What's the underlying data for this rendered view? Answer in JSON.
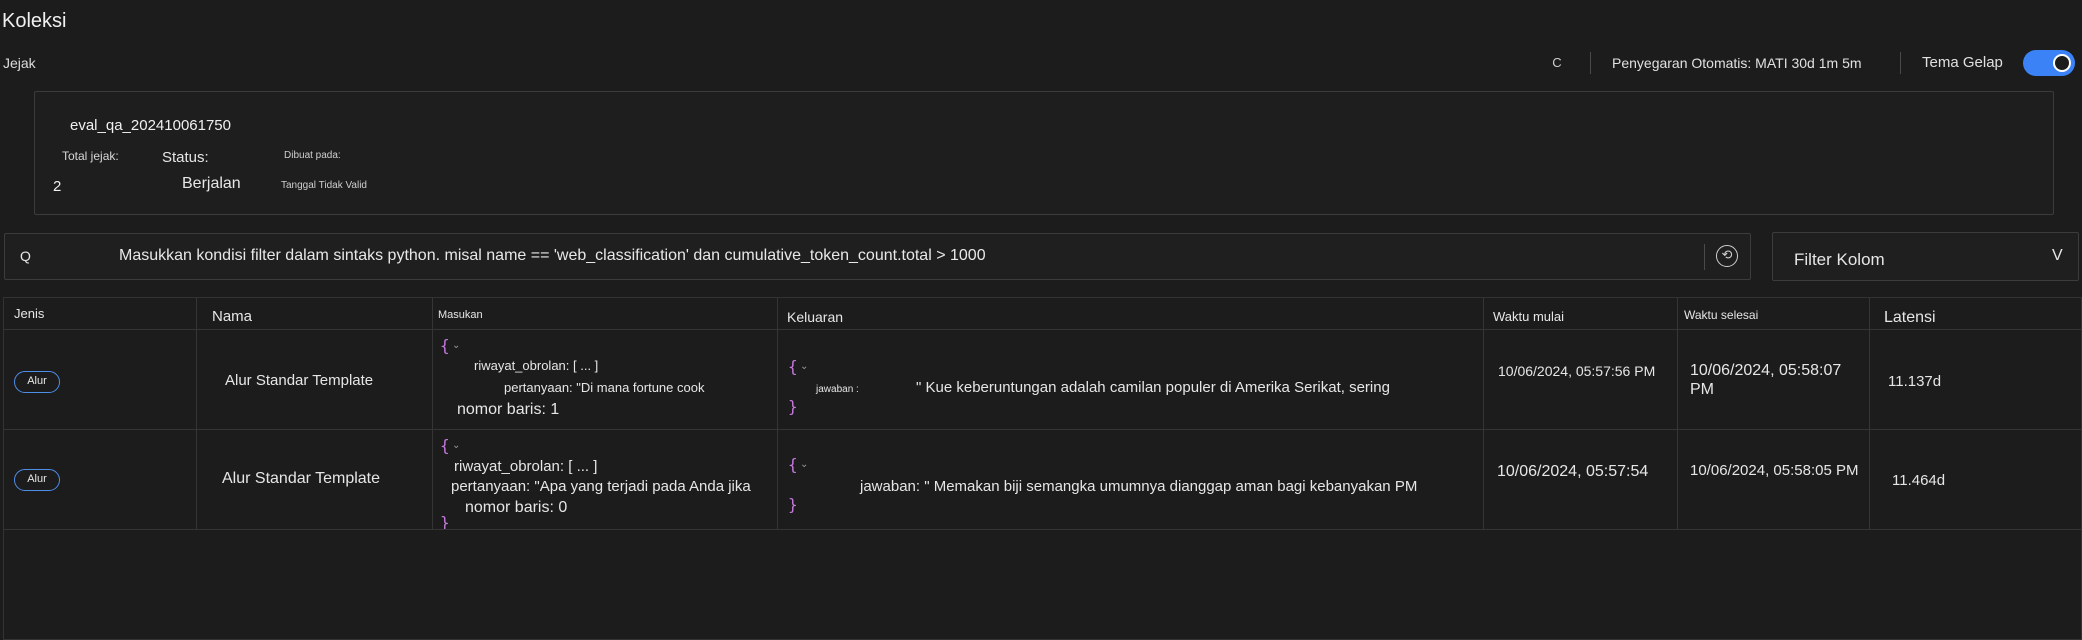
{
  "header": {
    "title": "Koleksi",
    "subtitle": "Jejak",
    "refresh_icon": "C",
    "auto_refresh": "Penyegaran Otomatis: MATI 30d 1m 5m",
    "theme_label": "Tema Gelap",
    "theme_dark_on": true
  },
  "run": {
    "name": "eval_qa_202410061750",
    "total_label": "Total jejak:",
    "total_value": "2",
    "status_label": "Status:",
    "status_value": "Berjalan",
    "created_label": "Dibuat pada:",
    "created_value": "Tanggal Tidak Valid"
  },
  "search": {
    "icon": "Q",
    "placeholder": "Masukkan kondisi filter dalam sintaks python. misal name == 'web_classification' dan cumulative_token_count.total > 1000"
  },
  "filter": {
    "label": "Filter Kolom",
    "chevron": "V"
  },
  "table": {
    "headers": {
      "type": "Jenis",
      "name": "Nama",
      "input": "Masukan",
      "output": "Keluaran",
      "start": "Waktu mulai",
      "end": "Waktu selesai",
      "latency": "Latensi"
    },
    "rows": [
      {
        "type": "Alur",
        "name": "Alur Standar Template",
        "open_brace": "{",
        "close_brace": "}",
        "input_history": "riwayat_obrolan: [ ... ]",
        "input_question": "pertanyaan: \"Di mana fortune cook",
        "input_line": "nomor baris: 1",
        "output_key": "jawaban :",
        "output_value": "\" Kue keberuntungan adalah camilan populer di Amerika Serikat, sering",
        "start": "10/06/2024, 05:57:56 PM",
        "end": "10/06/2024, 05:58:07 PM",
        "latency": "11.137d"
      },
      {
        "type": "Alur",
        "name": "Alur Standar Template",
        "open_brace": "{",
        "close_brace": "}",
        "input_history": "riwayat_obrolan: [ ... ]",
        "input_question": "pertanyaan: \"Apa yang terjadi pada Anda jika",
        "input_line": "nomor baris: 0",
        "output_key": "",
        "output_value": "jawaban: \" Memakan biji semangka umumnya dianggap aman bagi kebanyakan PM",
        "start": "10/06/2024, 05:57:54",
        "end": "10/06/2024, 05:58:05 PM",
        "latency": "11.464d"
      }
    ]
  }
}
